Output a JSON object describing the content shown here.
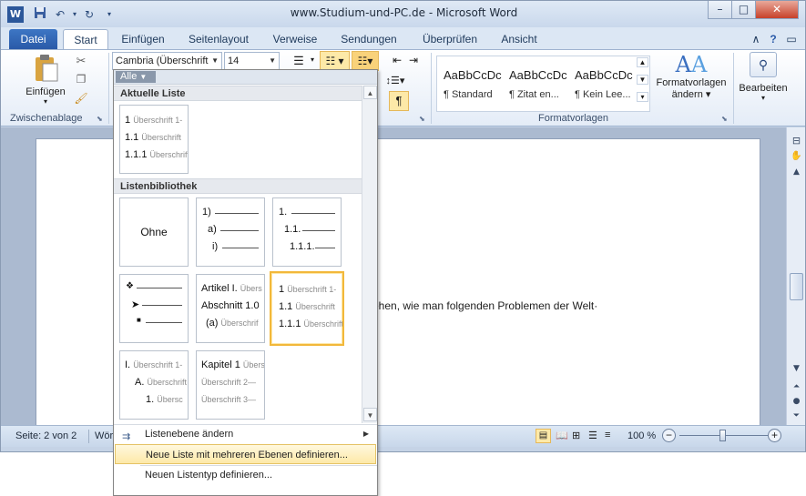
{
  "window": {
    "title": "www.Studium-und-PC.de - Microsoft Word",
    "controls": [
      "–",
      "□",
      "✕"
    ]
  },
  "qat": {
    "word_icon": "W"
  },
  "tabs": [
    {
      "label": "Datei"
    },
    {
      "label": "Start"
    },
    {
      "label": "Einfügen"
    },
    {
      "label": "Seitenlayout"
    },
    {
      "label": "Verweise"
    },
    {
      "label": "Sendungen"
    },
    {
      "label": "Überprüfen"
    },
    {
      "label": "Ansicht"
    }
  ],
  "ribbon": {
    "clipboard": {
      "paste_label": "Einfügen",
      "group_label": "Zwischenablage"
    },
    "font": {
      "family": "Cambria (Überschrift",
      "size": "14"
    },
    "styles": {
      "group_label": "Formatvorlagen",
      "items": [
        {
          "sample": "AaBbCcDc",
          "name": "¶ Standard"
        },
        {
          "sample": "AaBbCcDc",
          "name": "¶ Zitat en..."
        },
        {
          "sample": "AaBbCcDc",
          "name": "¶ Kein Lee..."
        }
      ],
      "change_label_line1": "Formatvorlagen",
      "change_label_line2": "ändern"
    },
    "edit": {
      "label": "Bearbeiten"
    }
  },
  "document": {
    "text": "ehen, wie man folgenden Problemen der Welt·"
  },
  "statusbar": {
    "page": "Seite: 2 von 2",
    "words": "Wör",
    "zoom": "100 %"
  },
  "gallery": {
    "filter": "Alle",
    "section_current": "Aktuelle Liste",
    "section_library": "Listenbibliothek",
    "current_list": [
      {
        "num": "1",
        "text": "Überschrift 1-"
      },
      {
        "num": "1.1",
        "text": "Überschrift"
      },
      {
        "num": "1.1.1",
        "text": "Überschrift"
      }
    ],
    "none_label": "Ohne",
    "tile_paren": [
      "1)",
      "a)",
      "i)"
    ],
    "tile_decimal": [
      "1.",
      "1.1.",
      "1.1.1."
    ],
    "tile_article": [
      {
        "num": "Artikel I.",
        "text": "Übers"
      },
      {
        "num": "Abschnitt 1.0",
        "text": ""
      },
      {
        "num": "(a)",
        "text": "Überschrif"
      }
    ],
    "tile_heading_selected": [
      {
        "num": "1",
        "text": "Überschrift 1-"
      },
      {
        "num": "1.1",
        "text": "Überschrift"
      },
      {
        "num": "1.1.1",
        "text": "Überschrift"
      }
    ],
    "tile_roman": [
      {
        "num": "I.",
        "text": "Überschrift 1-"
      },
      {
        "num": "A.",
        "text": "Überschrift"
      },
      {
        "num": "1.",
        "text": "Übersc"
      }
    ],
    "tile_chapter": [
      {
        "num": "Kapitel 1",
        "text": "Übersc"
      },
      {
        "num": "",
        "text": "Überschrift 2—"
      },
      {
        "num": "",
        "text": "Überschrift 3—"
      }
    ],
    "menu_items": [
      {
        "label": "Listenebene ändern"
      },
      {
        "label": "Neue Liste mit mehreren Ebenen definieren..."
      },
      {
        "label": "Neuen Listentyp definieren..."
      }
    ]
  }
}
